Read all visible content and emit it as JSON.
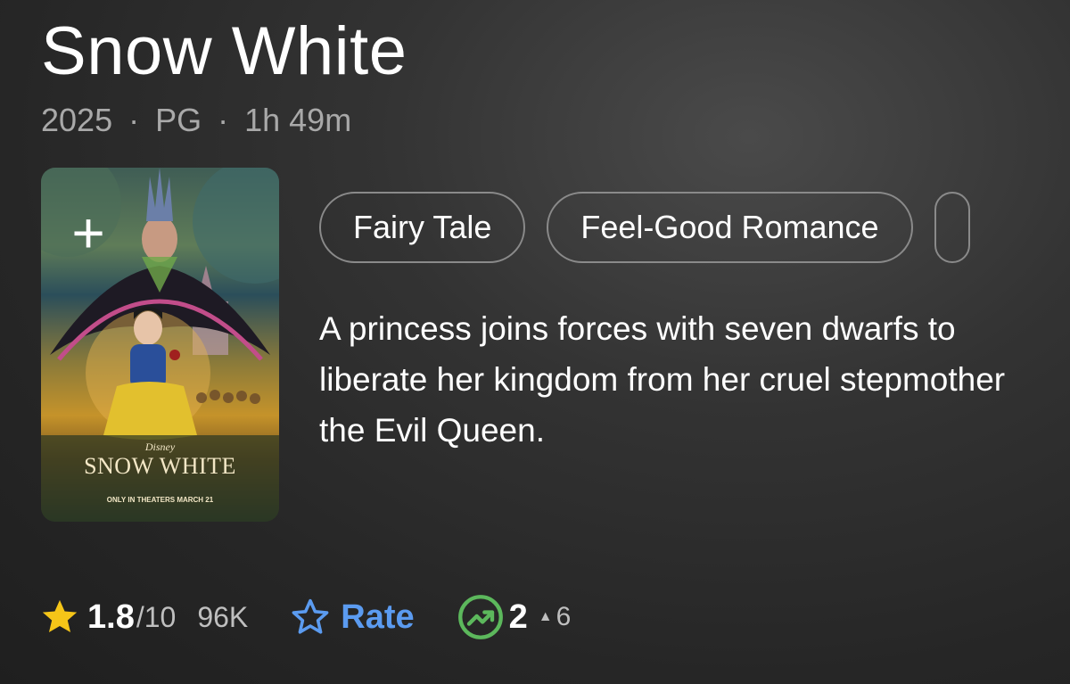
{
  "title": "Snow White",
  "meta": {
    "year": "2025",
    "rating": "PG",
    "runtime": "1h 49m",
    "separator": "·"
  },
  "poster": {
    "add_symbol": "+",
    "brand": "Disney",
    "logo_text": "SNOW WHITE",
    "release": "ONLY IN THEATERS MARCH 21"
  },
  "genres": [
    "Fairy Tale",
    "Feel-Good Romance"
  ],
  "description": "A princess joins forces with seven dwarfs to liberate her kingdom from her cruel stepmother the Evil Queen.",
  "ratings": {
    "score": "1.8",
    "max": "/10",
    "votes": "96K",
    "rate_label": "Rate",
    "popularity_rank": "2",
    "popularity_change": "6",
    "star_color": "#f5c518",
    "rate_color": "#5b9bf0",
    "trend_color": "#5cb85c"
  },
  "icons": {
    "star": "star-icon",
    "rate": "star-outline-icon",
    "trend": "trending-up-icon",
    "add": "plus-icon",
    "up": "triangle-up-icon"
  }
}
